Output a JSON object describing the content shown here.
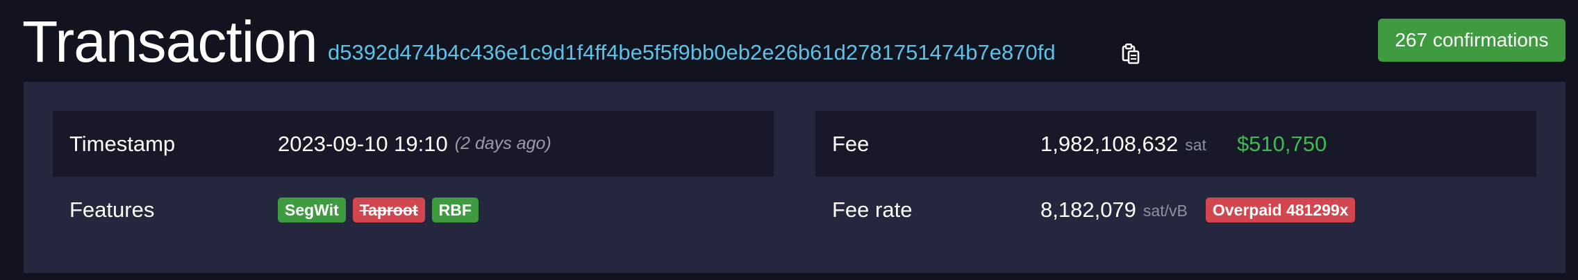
{
  "header": {
    "title": "Transaction",
    "txid": "d5392d474b4c436e1c9d1f4ff4be5f5f9bb0eb2e26b61d2781751474b7e870fd",
    "confirmations": "267 confirmations"
  },
  "details_left": {
    "timestamp_label": "Timestamp",
    "timestamp_value": "2023-09-10 19:10",
    "timestamp_relative": "(2 days ago)",
    "features_label": "Features",
    "features": [
      {
        "label": "SegWit",
        "status": "enabled"
      },
      {
        "label": "Taproot",
        "status": "disabled"
      },
      {
        "label": "RBF",
        "status": "enabled"
      }
    ]
  },
  "details_right": {
    "fee_label": "Fee",
    "fee_value": "1,982,108,632",
    "fee_unit": "sat",
    "fee_fiat": "$510,750",
    "fee_rate_label": "Fee rate",
    "fee_rate_value": "8,182,079",
    "fee_rate_unit": "sat/vB",
    "fee_rate_badge": "Overpaid 481299x"
  },
  "colors": {
    "background": "#11131f",
    "panel": "#24273e",
    "row_dark": "#171929",
    "link": "#5dc1e8",
    "success": "#3e9b40",
    "danger": "#d2474f",
    "fiat": "#3fb950"
  },
  "icons": {
    "copy": "clipboard-icon"
  }
}
